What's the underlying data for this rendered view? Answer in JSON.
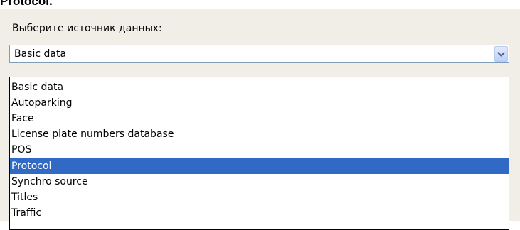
{
  "caption": "Protocol.",
  "dialog": {
    "prompt_label": "Выберите источник данных:",
    "combo_value": "Basic data",
    "combo_button_icon": "chevron-down-icon"
  },
  "dropdown": {
    "selected_index": 5,
    "selection_color": "#316ac5",
    "items": [
      "Basic data",
      "Autoparking",
      "Face",
      "License plate numbers database",
      "POS",
      "Protocol",
      "Synchro source",
      "Titles",
      "Traffic"
    ]
  }
}
